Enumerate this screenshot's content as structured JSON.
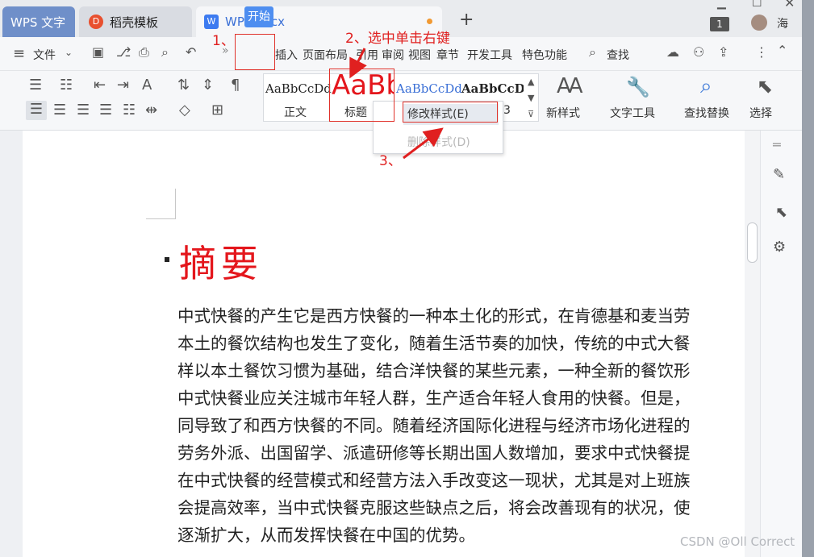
{
  "tabs": {
    "wps": "WPS 文字",
    "daoke": "稻壳模板",
    "doc": "WPS.docx",
    "new_tab": "+",
    "window_count": "1",
    "user": "海"
  },
  "menubar": {
    "file": "文件",
    "start": "开始",
    "items": [
      "插入",
      "页面布局",
      "引用",
      "审阅",
      "视图",
      "章节",
      "开发工具",
      "特色功能"
    ],
    "search": "查找"
  },
  "ribbon": {
    "styles": {
      "normal_sample": "AaBbCcDd",
      "normal_label": "正文",
      "title_sample": "AaBb",
      "title_label": "标题",
      "h1_sample": "AaBbCcDd",
      "h2_sample": "AaBbCcDd",
      "h2_label": "3"
    },
    "new_style": "新样式",
    "text_tools": "文字工具",
    "find_replace": "查找替换",
    "select": "选择"
  },
  "context_menu": {
    "modify": "修改样式(E)",
    "delete": "删除样式(D)"
  },
  "annotations": {
    "step1": "1、",
    "step2": "2、选中单击右键",
    "step3": "3、"
  },
  "document": {
    "heading": "摘要",
    "lines": [
      "中式快餐的产生它是西方快餐的一种本土化的形式，在肯德基和麦当劳",
      "本土的餐饮结构也发生了变化，随着生活节奏的加快，传统的中式大餐",
      "样以本土餐饮习惯为基础，结合洋快餐的某些元素，一种全新的餐饮形",
      "中式快餐业应关注城市年轻人群，生产适合年轻人食用的快餐。但是，",
      "同导致了和西方快餐的不同。随着经济国际化进程与经济市场化进程的",
      "劳务外派、出国留学、派遣研修等长期出国人数增加，要求中式快餐提",
      "在中式快餐的经营模式和经营方法入手改变这一现状，尤其是对上班族",
      "会提高效率，当中式快餐克服这些缺点之后，将会改善现有的状况，使",
      "逐渐扩大，从而发挥快餐在中国的优势。"
    ]
  },
  "watermark": "CSDN @Oll Correct",
  "colors": {
    "accent": "#4e8ef0",
    "annotation_red": "#e02020",
    "heading_red": "#e4161c"
  }
}
